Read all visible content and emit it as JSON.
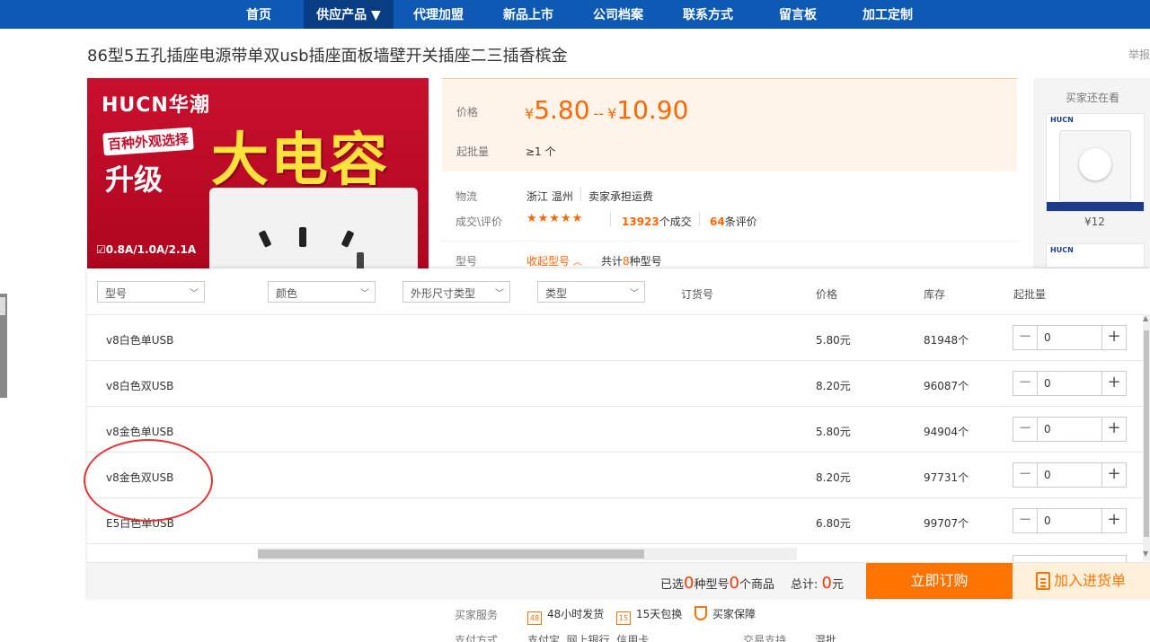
{
  "nav": {
    "items": [
      "首页",
      "供应产品 ▼",
      "代理加盟",
      "新品上市",
      "公司档案",
      "联系方式",
      "留言板",
      "加工定制"
    ]
  },
  "product": {
    "title": "86型5五孔插座电源带单双usb插座面板墙壁开关插座二三插香槟金",
    "report": "举报"
  },
  "image": {
    "brand": "HUCN华潮",
    "tag1": "百种外观选择",
    "tag2": "升级",
    "headline": "大电容",
    "spec": "☑0.8A/1.0A/2.1A"
  },
  "price": {
    "label": "价格",
    "currency": "¥",
    "low": "5.80",
    "sep": "--",
    "high": "10.90",
    "min_order_label": "起批量",
    "min_order": "≥1 个"
  },
  "info": {
    "logistics_label": "物流",
    "logistics_location": "浙江 温州",
    "logistics_fee": "卖家承担运费",
    "deals_label": "成交\\评价",
    "stars": "★★★★★",
    "deals_count": "13923",
    "deals_suffix": "个成交",
    "reviews_count": "64",
    "reviews_suffix": "条评价",
    "model_label": "型号",
    "collapse": "收起型号",
    "total_prefix": "共计",
    "total_num": "8",
    "total_suffix": "种型号"
  },
  "recommend": {
    "title": "买家还在看",
    "price": "¥12"
  },
  "table": {
    "filters": [
      "型号",
      "颜色",
      "外形尺寸类型",
      "类型"
    ],
    "headers": {
      "order_no": "订货号",
      "price": "价格",
      "stock": "库存",
      "min_qty": "起批量"
    },
    "rows": [
      {
        "name": "v8白色单USB",
        "price": "5.80元",
        "stock": "81948个",
        "qty": "0"
      },
      {
        "name": "v8白色双USB",
        "price": "8.20元",
        "stock": "96087个",
        "qty": "0"
      },
      {
        "name": "v8金色单USB",
        "price": "5.80元",
        "stock": "94904个",
        "qty": "0"
      },
      {
        "name": "v8金色双USB",
        "price": "8.20元",
        "stock": "97731个",
        "qty": "0"
      },
      {
        "name": "E5白色单USB",
        "price": "6.80元",
        "stock": "99707个",
        "qty": "0"
      }
    ]
  },
  "cart": {
    "selected_prefix": "已选",
    "model_count": "0",
    "model_suffix": "种型号",
    "item_count": "0",
    "item_suffix": "个商品",
    "total_label": "总计:",
    "total_value": "0",
    "total_unit": "元",
    "buy_now": "立即订购",
    "add_cart": "加入进货单"
  },
  "services": {
    "label": "买家服务",
    "ship_icon": "48",
    "ship": "48小时发货",
    "return_icon": "15",
    "return": "15天包换",
    "protect": "买家保障",
    "pay_label": "支付方式",
    "pay_methods": "支付宝  网上银行  信用卡",
    "support_label": "交易支持",
    "support_value": "混批"
  }
}
